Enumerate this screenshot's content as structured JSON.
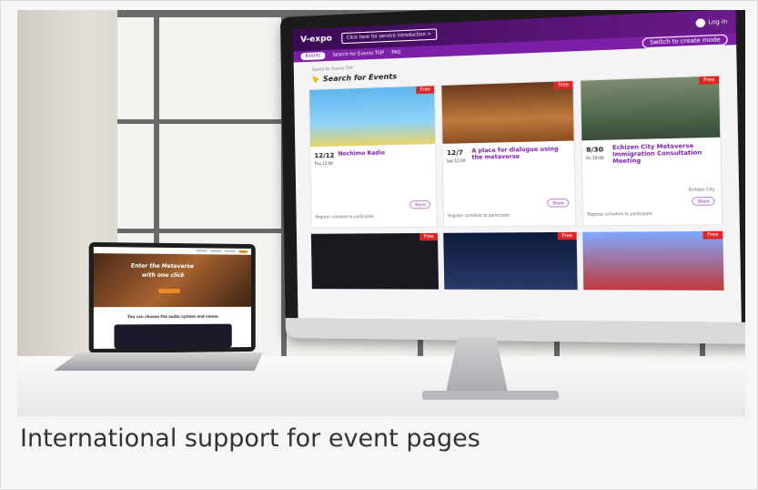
{
  "caption": "International support for event pages",
  "imac_site": {
    "logo": "V-expo",
    "intro_button": "Click here for service introduction >",
    "login": "Log in",
    "nav_active": "Events",
    "nav_links": [
      "Search for Events TOP",
      "FAQ"
    ],
    "create_mode": "Switch to create mode",
    "breadcrumb": "Search for Events TOP",
    "search_title": "Search for Events",
    "badge": "Free",
    "events": [
      {
        "date": "12/12",
        "day": "Thu 12:00",
        "title": "Nochimo Radio",
        "share": "Share",
        "sched": "Register schedule to participate"
      },
      {
        "date": "12/7",
        "day": "Sat 12:00",
        "title": "A place for dialogue using the metaverse",
        "share": "Share",
        "sched": "Register schedule to participate"
      },
      {
        "date": "8/30",
        "day": "Fri 19:00",
        "title": "Echizen City Metaverse Immigration Consultation Meeting",
        "org": "Echizen City",
        "share": "Share",
        "sched": "Register schedule to participate"
      }
    ]
  },
  "laptop_site": {
    "hero_line1": "Enter the Metaverse",
    "hero_line2": "with one click",
    "tagline": "You can choose the audio system and venue."
  },
  "colors": {
    "brand_purple": "#7c1fa6",
    "badge_red": "#e02424"
  }
}
